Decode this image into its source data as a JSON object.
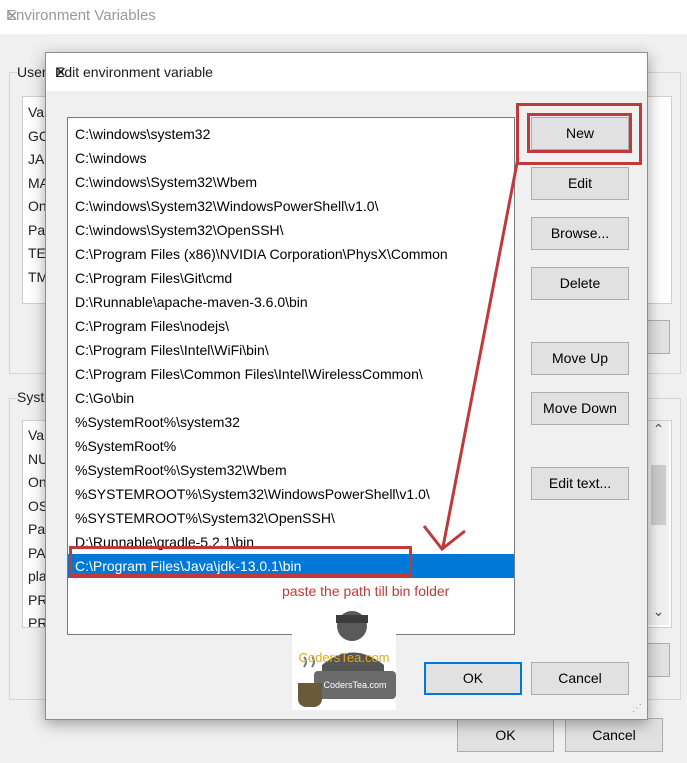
{
  "background_window": {
    "title": "Environment Variables",
    "user_group_label": "User",
    "user_vars": [
      "Va",
      "GC",
      "JA",
      "MA",
      "On",
      "Pa",
      "TE",
      "TM"
    ],
    "system_group_label": "Syste",
    "system_vars": [
      "Va",
      "NU",
      "On",
      "OS",
      "Pa",
      "PA",
      "pla",
      "PR",
      "PR"
    ],
    "ok_label": "OK",
    "cancel_label": "Cancel",
    "scroll_up": "⌃",
    "scroll_down": "⌄"
  },
  "dialog": {
    "title": "Edit environment variable",
    "paths": [
      "C:\\windows\\system32",
      "C:\\windows",
      "C:\\windows\\System32\\Wbem",
      "C:\\windows\\System32\\WindowsPowerShell\\v1.0\\",
      "C:\\windows\\System32\\OpenSSH\\",
      "C:\\Program Files (x86)\\NVIDIA Corporation\\PhysX\\Common",
      "C:\\Program Files\\Git\\cmd",
      "D:\\Runnable\\apache-maven-3.6.0\\bin",
      "C:\\Program Files\\nodejs\\",
      "C:\\Program Files\\Intel\\WiFi\\bin\\",
      "C:\\Program Files\\Common Files\\Intel\\WirelessCommon\\",
      "C:\\Go\\bin",
      "%SystemRoot%\\system32",
      "%SystemRoot%",
      "%SystemRoot%\\System32\\Wbem",
      "%SYSTEMROOT%\\System32\\WindowsPowerShell\\v1.0\\",
      "%SYSTEMROOT%\\System32\\OpenSSH\\",
      "D:\\Runnable\\gradle-5.2.1\\bin",
      "C:\\Program Files\\Java\\jdk-13.0.1\\bin"
    ],
    "selected_index": 18,
    "buttons": {
      "new": "New",
      "edit": "Edit",
      "browse": "Browse...",
      "delete": "Delete",
      "move_up": "Move Up",
      "move_down": "Move Down",
      "edit_text": "Edit text...",
      "ok": "OK",
      "cancel": "Cancel"
    }
  },
  "annotation": {
    "text": "paste the path till bin folder",
    "color": "#c0393b"
  },
  "watermark": {
    "brand_top": "CodersTea.com",
    "brand_bottom": "CodersTea.com"
  },
  "colors": {
    "selection": "#0078d7",
    "highlight_red": "#c0393b",
    "dialog_bg": "#f0f0f0"
  }
}
